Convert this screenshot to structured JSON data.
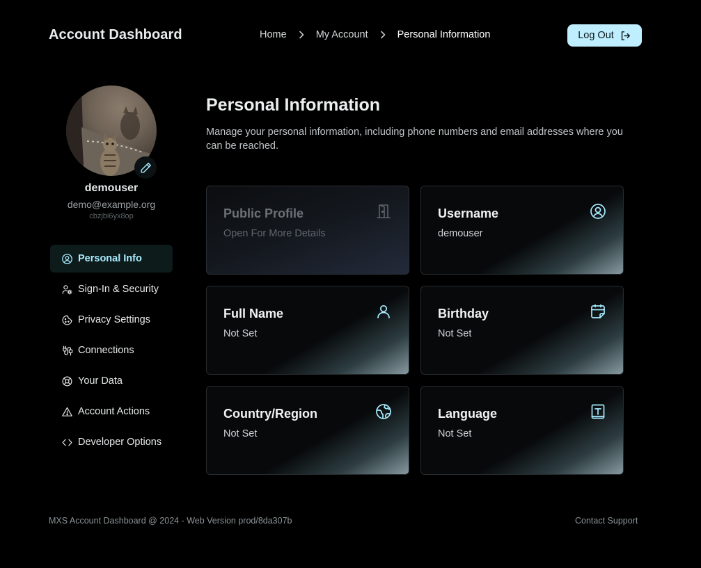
{
  "header": {
    "app_title": "Account Dashboard",
    "breadcrumbs": [
      "Home",
      "My Account",
      "Personal Information"
    ],
    "logout_label": "Log Out"
  },
  "profile": {
    "username": "demouser",
    "email": "demo@example.org",
    "user_id": "cbzjbi6yx8op"
  },
  "sidebar": {
    "items": [
      {
        "label": "Personal Info",
        "icon": "user-circle-icon",
        "active": true
      },
      {
        "label": "Sign-In & Security",
        "icon": "user-cog-icon"
      },
      {
        "label": "Privacy Settings",
        "icon": "cookie-icon"
      },
      {
        "label": "Connections",
        "icon": "plug-connection-icon"
      },
      {
        "label": "Your Data",
        "icon": "lifebuoy-icon"
      },
      {
        "label": "Account Actions",
        "icon": "warning-triangle-icon"
      },
      {
        "label": "Developer Options",
        "icon": "code-icon"
      }
    ]
  },
  "main": {
    "title": "Personal Information",
    "description": "Manage your personal information, including phone numbers and email addresses where you can be reached.",
    "cards": [
      {
        "title": "Public Profile",
        "value": "Open For More Details",
        "icon": "door-open-icon"
      },
      {
        "title": "Username",
        "value": "demouser",
        "icon": "user-circle-icon"
      },
      {
        "title": "Full Name",
        "value": "Not Set",
        "icon": "user-icon"
      },
      {
        "title": "Birthday",
        "value": "Not Set",
        "icon": "calendar-icon"
      },
      {
        "title": "Country/Region",
        "value": "Not Set",
        "icon": "globe-icon"
      },
      {
        "title": "Language",
        "value": "Not Set",
        "icon": "text-language-icon"
      }
    ]
  },
  "footer": {
    "version_text": "MXS Account Dashboard @ 2024 - Web Version prod/8da307b",
    "support_label": "Contact Support"
  },
  "colors": {
    "background": "#000000",
    "accent": "#a8ecff",
    "button_bg": "#bfefff"
  }
}
